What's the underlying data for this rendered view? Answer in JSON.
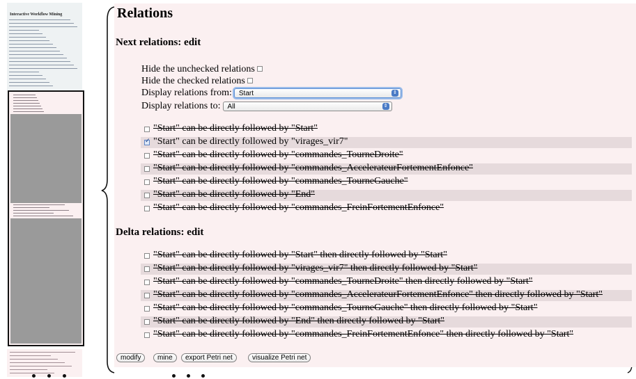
{
  "page_title": "Relations",
  "next_section": {
    "heading": "Next relations: edit",
    "hide_unchecked_label": "Hide the unchecked relations",
    "hide_checked_label": "Hide the checked relations",
    "display_from_label": "Display relations from:",
    "display_from_value": "Start",
    "display_to_label": "Display relations to:",
    "display_to_value": "All",
    "relations": [
      {
        "text": "\"Start\" can be directly followed by \"Start\"",
        "checked": false
      },
      {
        "text": "\"Start\" can be directly followed by \"virages_vir7\"",
        "checked": true
      },
      {
        "text": "\"Start\" can be directly followed by \"commandes_TourneDroite\"",
        "checked": false
      },
      {
        "text": "\"Start\" can be directly followed by \"commandes_AccelerateurFortementEnfonce\"",
        "checked": false
      },
      {
        "text": "\"Start\" can be directly followed by \"commandes_TourneGauche\"",
        "checked": false
      },
      {
        "text": "\"Start\" can be directly followed by \"End\"",
        "checked": false
      },
      {
        "text": "\"Start\" can be directly followed by \"commandes_FreinFortementEnfonce\"",
        "checked": false
      }
    ]
  },
  "delta_section": {
    "heading": "Delta relations: edit",
    "relations": [
      {
        "text": "\"Start\" can be directly followed by \"Start\" then directly followed by \"Start\"",
        "checked": false
      },
      {
        "text": "\"Start\" can be directly followed by \"virages_vir7\" then directly followed by \"Start\"",
        "checked": false
      },
      {
        "text": "\"Start\" can be directly followed by \"commandes_TourneDroite\" then directly followed by \"Start\"",
        "checked": false
      },
      {
        "text": "\"Start\" can be directly followed by \"commandes_AccelerateurFortementEnfonce\" then directly followed by \"Start\"",
        "checked": false
      },
      {
        "text": "\"Start\" can be directly followed by \"commandes_TourneGauche\" then directly followed by \"Start\"",
        "checked": false
      },
      {
        "text": "\"Start\" can be directly followed by \"End\" then directly followed by \"Start\"",
        "checked": false
      },
      {
        "text": "\"Start\" can be directly followed by \"commandes_FreinFortementEnfonce\" then directly followed by \"Start\"",
        "checked": false
      }
    ]
  },
  "buttons": {
    "modify": "modify",
    "mine": "mine",
    "export": "export Petri net",
    "visualize": "visualize Petri net"
  },
  "thumbnail": {
    "title": "Interactive Workflow Mining"
  },
  "colors": {
    "panel_bg": "#fbf0f1",
    "row_shade": "#e6dadc",
    "select_focus": "#5d8fd6"
  }
}
